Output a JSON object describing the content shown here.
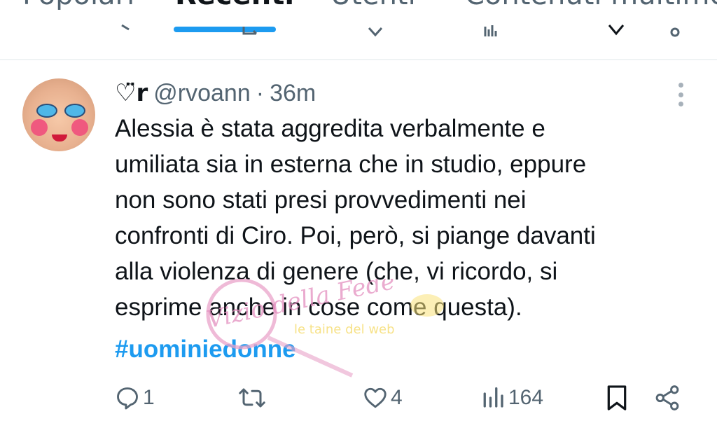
{
  "tabs": [
    {
      "label": "Popolari"
    },
    {
      "label": "Recenti",
      "active": true
    },
    {
      "label": "Utenti"
    },
    {
      "label": "Contenuti multimediali"
    }
  ],
  "tweet": {
    "display_name": "♡̈r",
    "handle": "@rvoann",
    "separator": "·",
    "time": "36m",
    "text": "Alessia è stata aggredita verbalmente e\numiliata sia in esterna che in studio, eppure\nnon sono stati presi provvedimenti nei\nconfronti di Ciro. Poi, però, si piange davanti\nalla violenza di genere (che, vi ricordo, si\nesprime anche in cose come questa).",
    "hashtag": "#uominiedonne",
    "replies": "1",
    "retweets": "",
    "likes": "4",
    "views": "164"
  },
  "icons": {
    "reply": "reply-icon",
    "retweet": "retweet-icon",
    "like": "heart-icon",
    "views": "views-icon",
    "bookmark": "bookmark-icon",
    "share": "share-icon",
    "more": "more-vertical-icon"
  },
  "colors": {
    "accent": "#1d9bf0",
    "text": "#0f1419",
    "muted": "#536471",
    "divider": "#eff3f4"
  },
  "watermark": {
    "text": "Vizio della Fede",
    "subtext": "le taine del web"
  }
}
